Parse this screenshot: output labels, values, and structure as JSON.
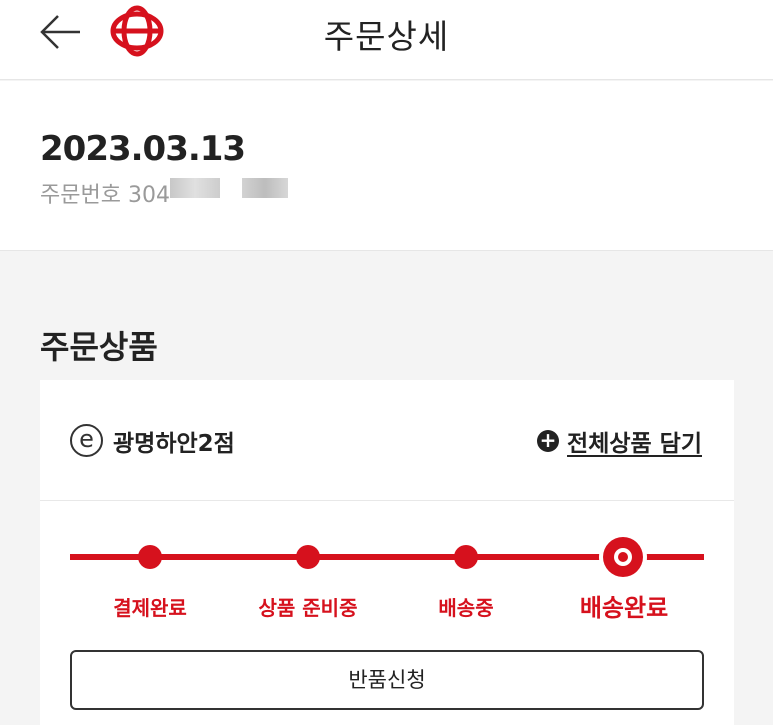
{
  "header": {
    "title": "주문상세",
    "back_icon": "arrow-left-icon",
    "logo_icon": "brand-logo-icon",
    "brand_color": "#d6111d"
  },
  "order": {
    "date": "2023.03.13",
    "number_label": "주문번호 304"
  },
  "section": {
    "title": "주문상품"
  },
  "store": {
    "icon": "e-store-icon",
    "icon_glyph": "e",
    "name": "광명하안2점",
    "add_all_label": "전체상품 담기",
    "add_all_icon": "plus-circle-icon"
  },
  "progress": {
    "steps": [
      {
        "label": "결제완료"
      },
      {
        "label": "상품 준비중"
      },
      {
        "label": "배송중"
      },
      {
        "label": "배송완료"
      }
    ],
    "current_step": 4
  },
  "actions": {
    "return_label": "반품신청"
  }
}
